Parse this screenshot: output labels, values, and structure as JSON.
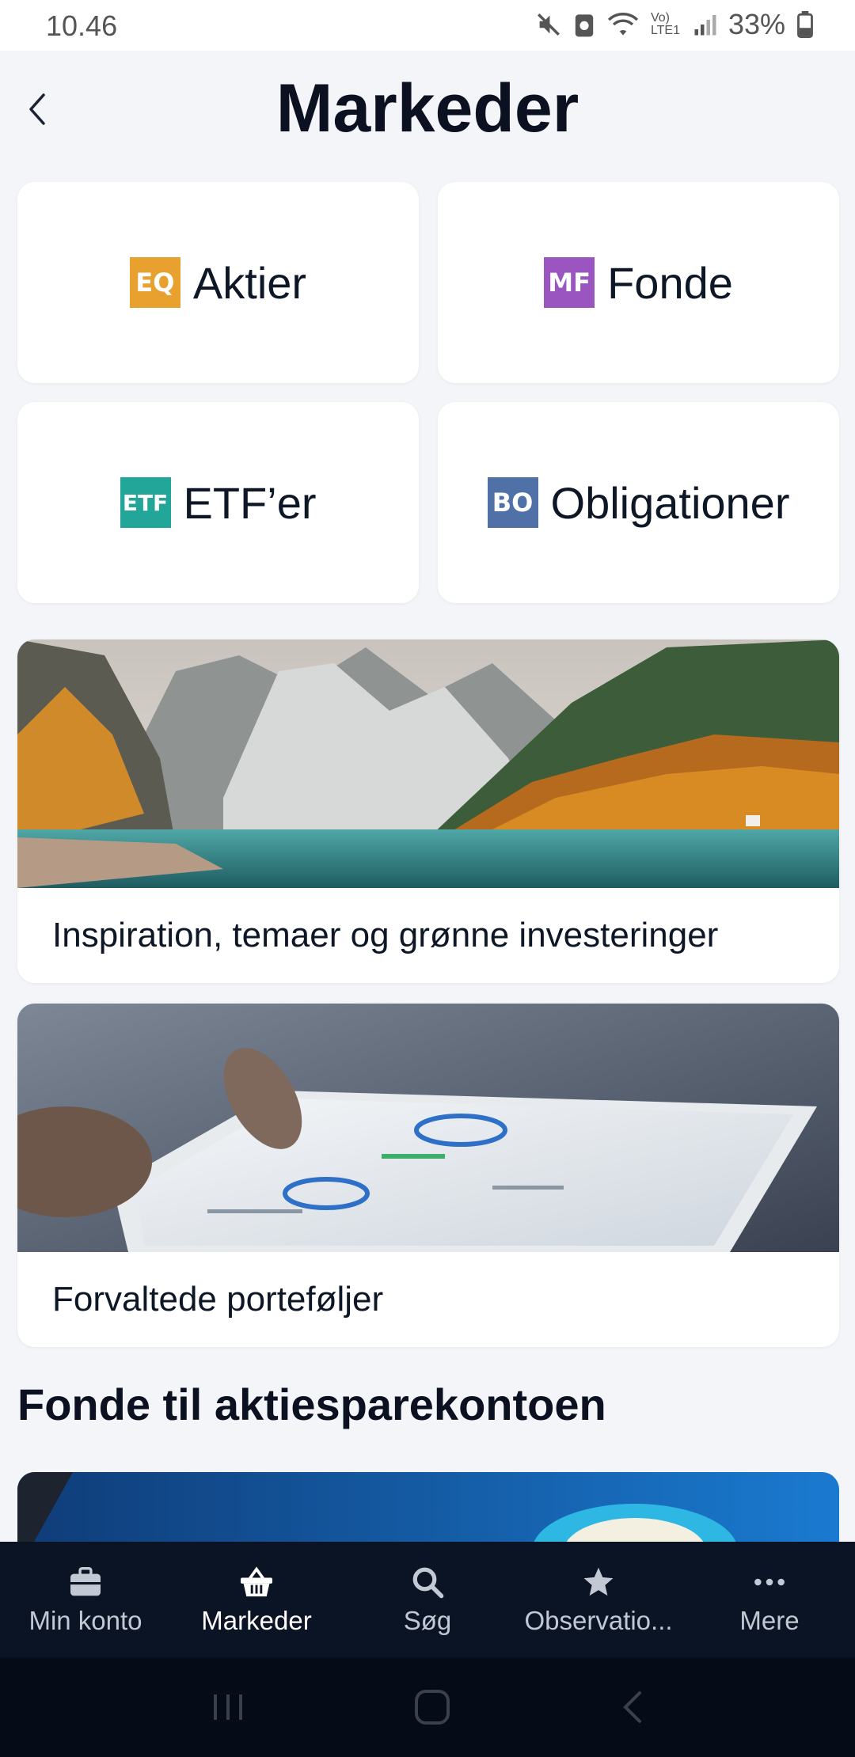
{
  "status_bar": {
    "time": "10.46",
    "battery": "33%",
    "network": "Vo) LTE1"
  },
  "header": {
    "title": "Markeder"
  },
  "markets": [
    {
      "badge": "EQ",
      "label": "Aktier",
      "color": "#e8a02f"
    },
    {
      "badge": "MF",
      "label": "Fonde",
      "color": "#9a55c1"
    },
    {
      "badge": "ETF",
      "label": "ETF’er",
      "color": "#23a69a"
    },
    {
      "badge": "BO",
      "label": "Obligationer",
      "color": "#4f71a8"
    }
  ],
  "features": [
    {
      "caption": "Inspiration, temaer og grønne investeringer"
    },
    {
      "caption": "Forvaltede porteføljer"
    }
  ],
  "section": {
    "title": "Fonde til aktiesparekontoen"
  },
  "bottom_nav": [
    {
      "label": "Min konto",
      "icon": "briefcase-icon"
    },
    {
      "label": "Markeder",
      "icon": "basket-icon"
    },
    {
      "label": "Søg",
      "icon": "search-icon"
    },
    {
      "label": "Observatio...",
      "icon": "star-icon"
    },
    {
      "label": "Mere",
      "icon": "more-icon"
    }
  ],
  "colors": {
    "background": "#f3f5f8",
    "nav_bg": "#0b1424",
    "system_nav_bg": "#050b17"
  }
}
